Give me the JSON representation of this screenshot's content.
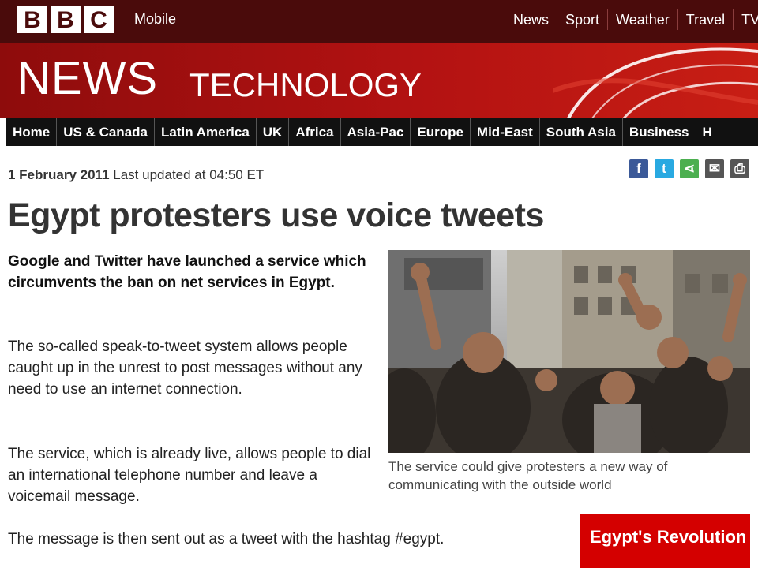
{
  "header": {
    "logo_letters": [
      "B",
      "B",
      "C"
    ],
    "mobile_label": "Mobile",
    "nav": [
      "News",
      "Sport",
      "Weather",
      "Travel",
      "TV"
    ]
  },
  "masthead": {
    "title": "NEWS",
    "section": "TECHNOLOGY"
  },
  "region_nav": [
    "Home",
    "US & Canada",
    "Latin America",
    "UK",
    "Africa",
    "Asia-Pac",
    "Europe",
    "Mid-East",
    "South Asia",
    "Business",
    "H"
  ],
  "article": {
    "date": "1 February 2011",
    "updated": "Last updated at 04:50 ET",
    "headline": "Egypt protesters use voice tweets",
    "intro": "Google and Twitter have launched a service which circumvents the ban on net services in Egypt.",
    "paragraphs": [
      "The so-called speak-to-tweet system allows people caught up in the unrest to post messages without any need to use an internet connection.",
      "The service, which is already live, allows people to dial an international telephone number and leave a voicemail message.",
      "The message is then sent out as a tweet with the hashtag #egypt."
    ],
    "image_caption": "The service could give protesters a new way of communicating with the outside world"
  },
  "share_icons": [
    {
      "name": "facebook-icon",
      "glyph": "f",
      "color": "#3b5998"
    },
    {
      "name": "twitter-icon",
      "glyph": "t",
      "color": "#29a9e1"
    },
    {
      "name": "share-icon",
      "glyph": "⋖",
      "color": "#4caf50"
    },
    {
      "name": "email-icon",
      "glyph": "✉",
      "color": "#555555"
    },
    {
      "name": "print-icon",
      "glyph": "⎙",
      "color": "#555555"
    }
  ],
  "promo": {
    "title": "Egypt's Revolution"
  },
  "colors": {
    "top_bar": "#4a0b0b",
    "masthead_red": "#b31212",
    "nav_bar": "#111111",
    "promo_red": "#d40000"
  }
}
